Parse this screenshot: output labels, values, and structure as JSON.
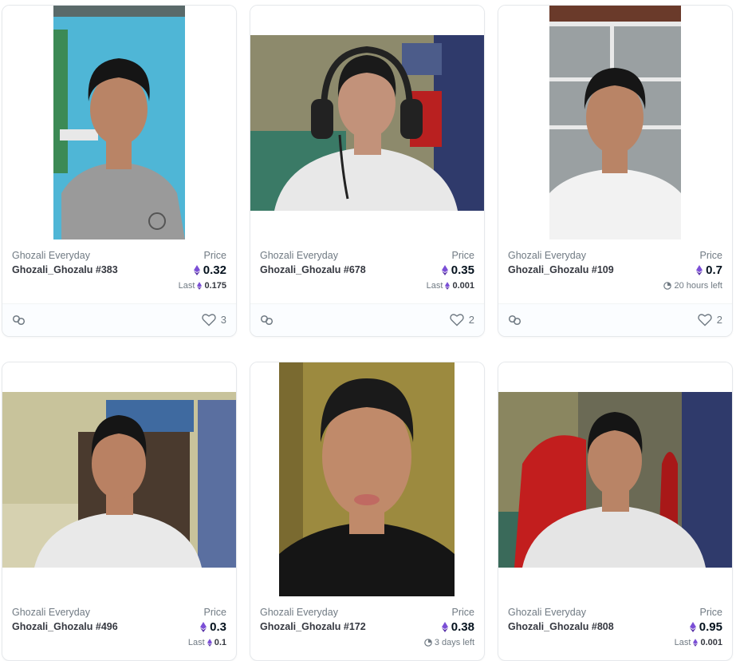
{
  "cards": [
    {
      "collection": "Ghozali Everyday",
      "name": "Ghozali_Ghozalu #383",
      "price_label": "Price",
      "price": "0.32",
      "sub_kind": "last",
      "sub_label": "Last",
      "sub_value": "0.175",
      "likes": "3",
      "photo": {
        "bg": "#4fb6d6",
        "shirt": "#9a9a9a",
        "skin": "#b98466",
        "hair": "#151515"
      }
    },
    {
      "collection": "Ghozali Everyday",
      "name": "Ghozali_Ghozalu #678",
      "price_label": "Price",
      "price": "0.35",
      "sub_kind": "last",
      "sub_label": "Last",
      "sub_value": "0.001",
      "likes": "2",
      "photo": {
        "bg": "#5c7a63",
        "shirt": "#e8e8e8",
        "skin": "#c2927a",
        "hair": "#1a1a1a"
      }
    },
    {
      "collection": "Ghozali Everyday",
      "name": "Ghozali_Ghozalu #109",
      "price_label": "Price",
      "price": "0.7",
      "sub_kind": "time",
      "sub_label": "",
      "sub_value": "20 hours left",
      "likes": "2",
      "photo": {
        "bg": "#9aa0a2",
        "shirt": "#f2f2f2",
        "skin": "#b98466",
        "hair": "#161616"
      }
    },
    {
      "collection": "Ghozali Everyday",
      "name": "Ghozali_Ghozalu #496",
      "price_label": "Price",
      "price": "0.3",
      "sub_kind": "last",
      "sub_label": "Last",
      "sub_value": "0.1",
      "likes": "",
      "photo": {
        "bg": "#c8c39b",
        "shirt": "#e9e9e9",
        "skin": "#b98163",
        "hair": "#151515"
      }
    },
    {
      "collection": "Ghozali Everyday",
      "name": "Ghozali_Ghozalu #172",
      "price_label": "Price",
      "price": "0.38",
      "sub_kind": "time",
      "sub_label": "",
      "sub_value": "3 days left",
      "likes": "",
      "photo": {
        "bg": "#9c8a3f",
        "shirt": "#151515",
        "skin": "#c08a6a",
        "hair": "#1a1a1a"
      }
    },
    {
      "collection": "Ghozali Everyday",
      "name": "Ghozali_Ghozalu #808",
      "price_label": "Price",
      "price": "0.95",
      "sub_kind": "last",
      "sub_label": "Last",
      "sub_value": "0.001",
      "likes": "",
      "photo": {
        "bg": "#6b6a55",
        "shirt": "#e5e5e5",
        "skin": "#b98466",
        "hair": "#151515"
      }
    }
  ],
  "colors": {
    "eth": "#7b4fd6",
    "text": "#353840",
    "muted": "#707a83"
  },
  "icons": {
    "currency": "ethereum-icon",
    "link": "link-icon",
    "like": "heart-icon",
    "time": "clock-icon"
  }
}
